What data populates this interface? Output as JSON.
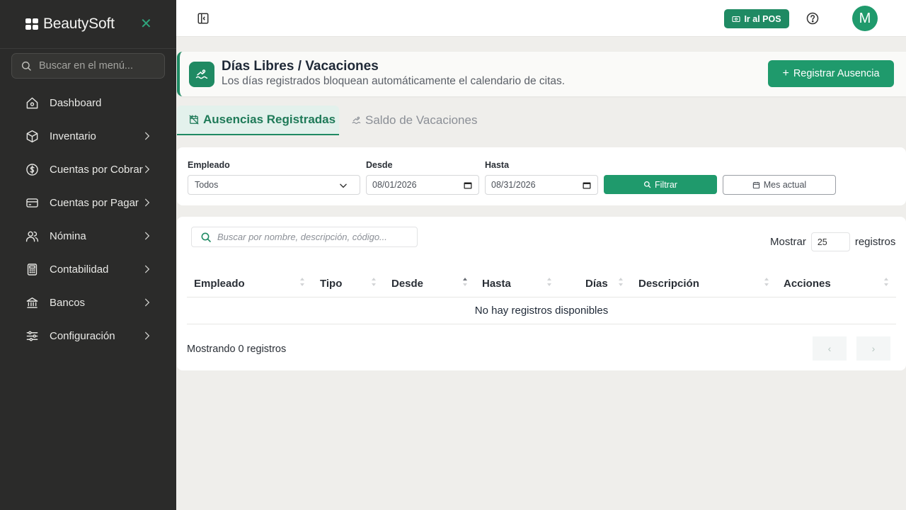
{
  "sidebar": {
    "brand": "BeautySoft",
    "search_placeholder": "Buscar en el menú...",
    "items": [
      {
        "label": "Dashboard",
        "icon": "home-icon",
        "chevron": false
      },
      {
        "label": "Inventario",
        "icon": "box-icon",
        "chevron": true
      },
      {
        "label": "Cuentas por Cobrar",
        "icon": "dollar-circle-icon",
        "chevron": true
      },
      {
        "label": "Cuentas por Pagar",
        "icon": "credit-card-icon",
        "chevron": true
      },
      {
        "label": "Nómina",
        "icon": "users-icon",
        "chevron": true
      },
      {
        "label": "Contabilidad",
        "icon": "calculator-icon",
        "chevron": true
      },
      {
        "label": "Bancos",
        "icon": "bank-icon",
        "chevron": true
      },
      {
        "label": "Configuración",
        "icon": "sliders-icon",
        "chevron": true
      }
    ]
  },
  "topbar": {
    "pos_label": "Ir al POS",
    "avatar_initial": "M"
  },
  "header": {
    "title": "Días Libres / Vacaciones",
    "subtitle": "Los días registrados bloquean automáticamente el calendario de citas.",
    "register_label": "Registrar Ausencia"
  },
  "tabs": [
    {
      "label": "Ausencias Registradas",
      "active": true
    },
    {
      "label": "Saldo de Vacaciones",
      "active": false
    }
  ],
  "filters": {
    "employee_label": "Empleado",
    "employee_value": "Todos",
    "from_label": "Desde",
    "from_value": "08/01/2026",
    "to_label": "Hasta",
    "to_value": "08/31/2026",
    "filter_label": "Filtrar",
    "month_label": "Mes actual"
  },
  "table": {
    "search_placeholder": "Buscar por nombre, descripción, código...",
    "show_prefix": "Mostrar",
    "show_value": "25",
    "show_suffix": "registros",
    "columns": [
      "Empleado",
      "Tipo",
      "Desde",
      "Hasta",
      "Días",
      "Descripción",
      "Acciones"
    ],
    "empty_message": "No hay registros disponibles",
    "footer_text": "Mostrando 0 registros",
    "prev_label": "‹",
    "next_label": "›"
  },
  "colors": {
    "accent": "#1f9a6c",
    "accent_dark": "#1f8a63",
    "sidebar_bg": "#2b2b2a",
    "page_bg": "#efeeeb"
  }
}
